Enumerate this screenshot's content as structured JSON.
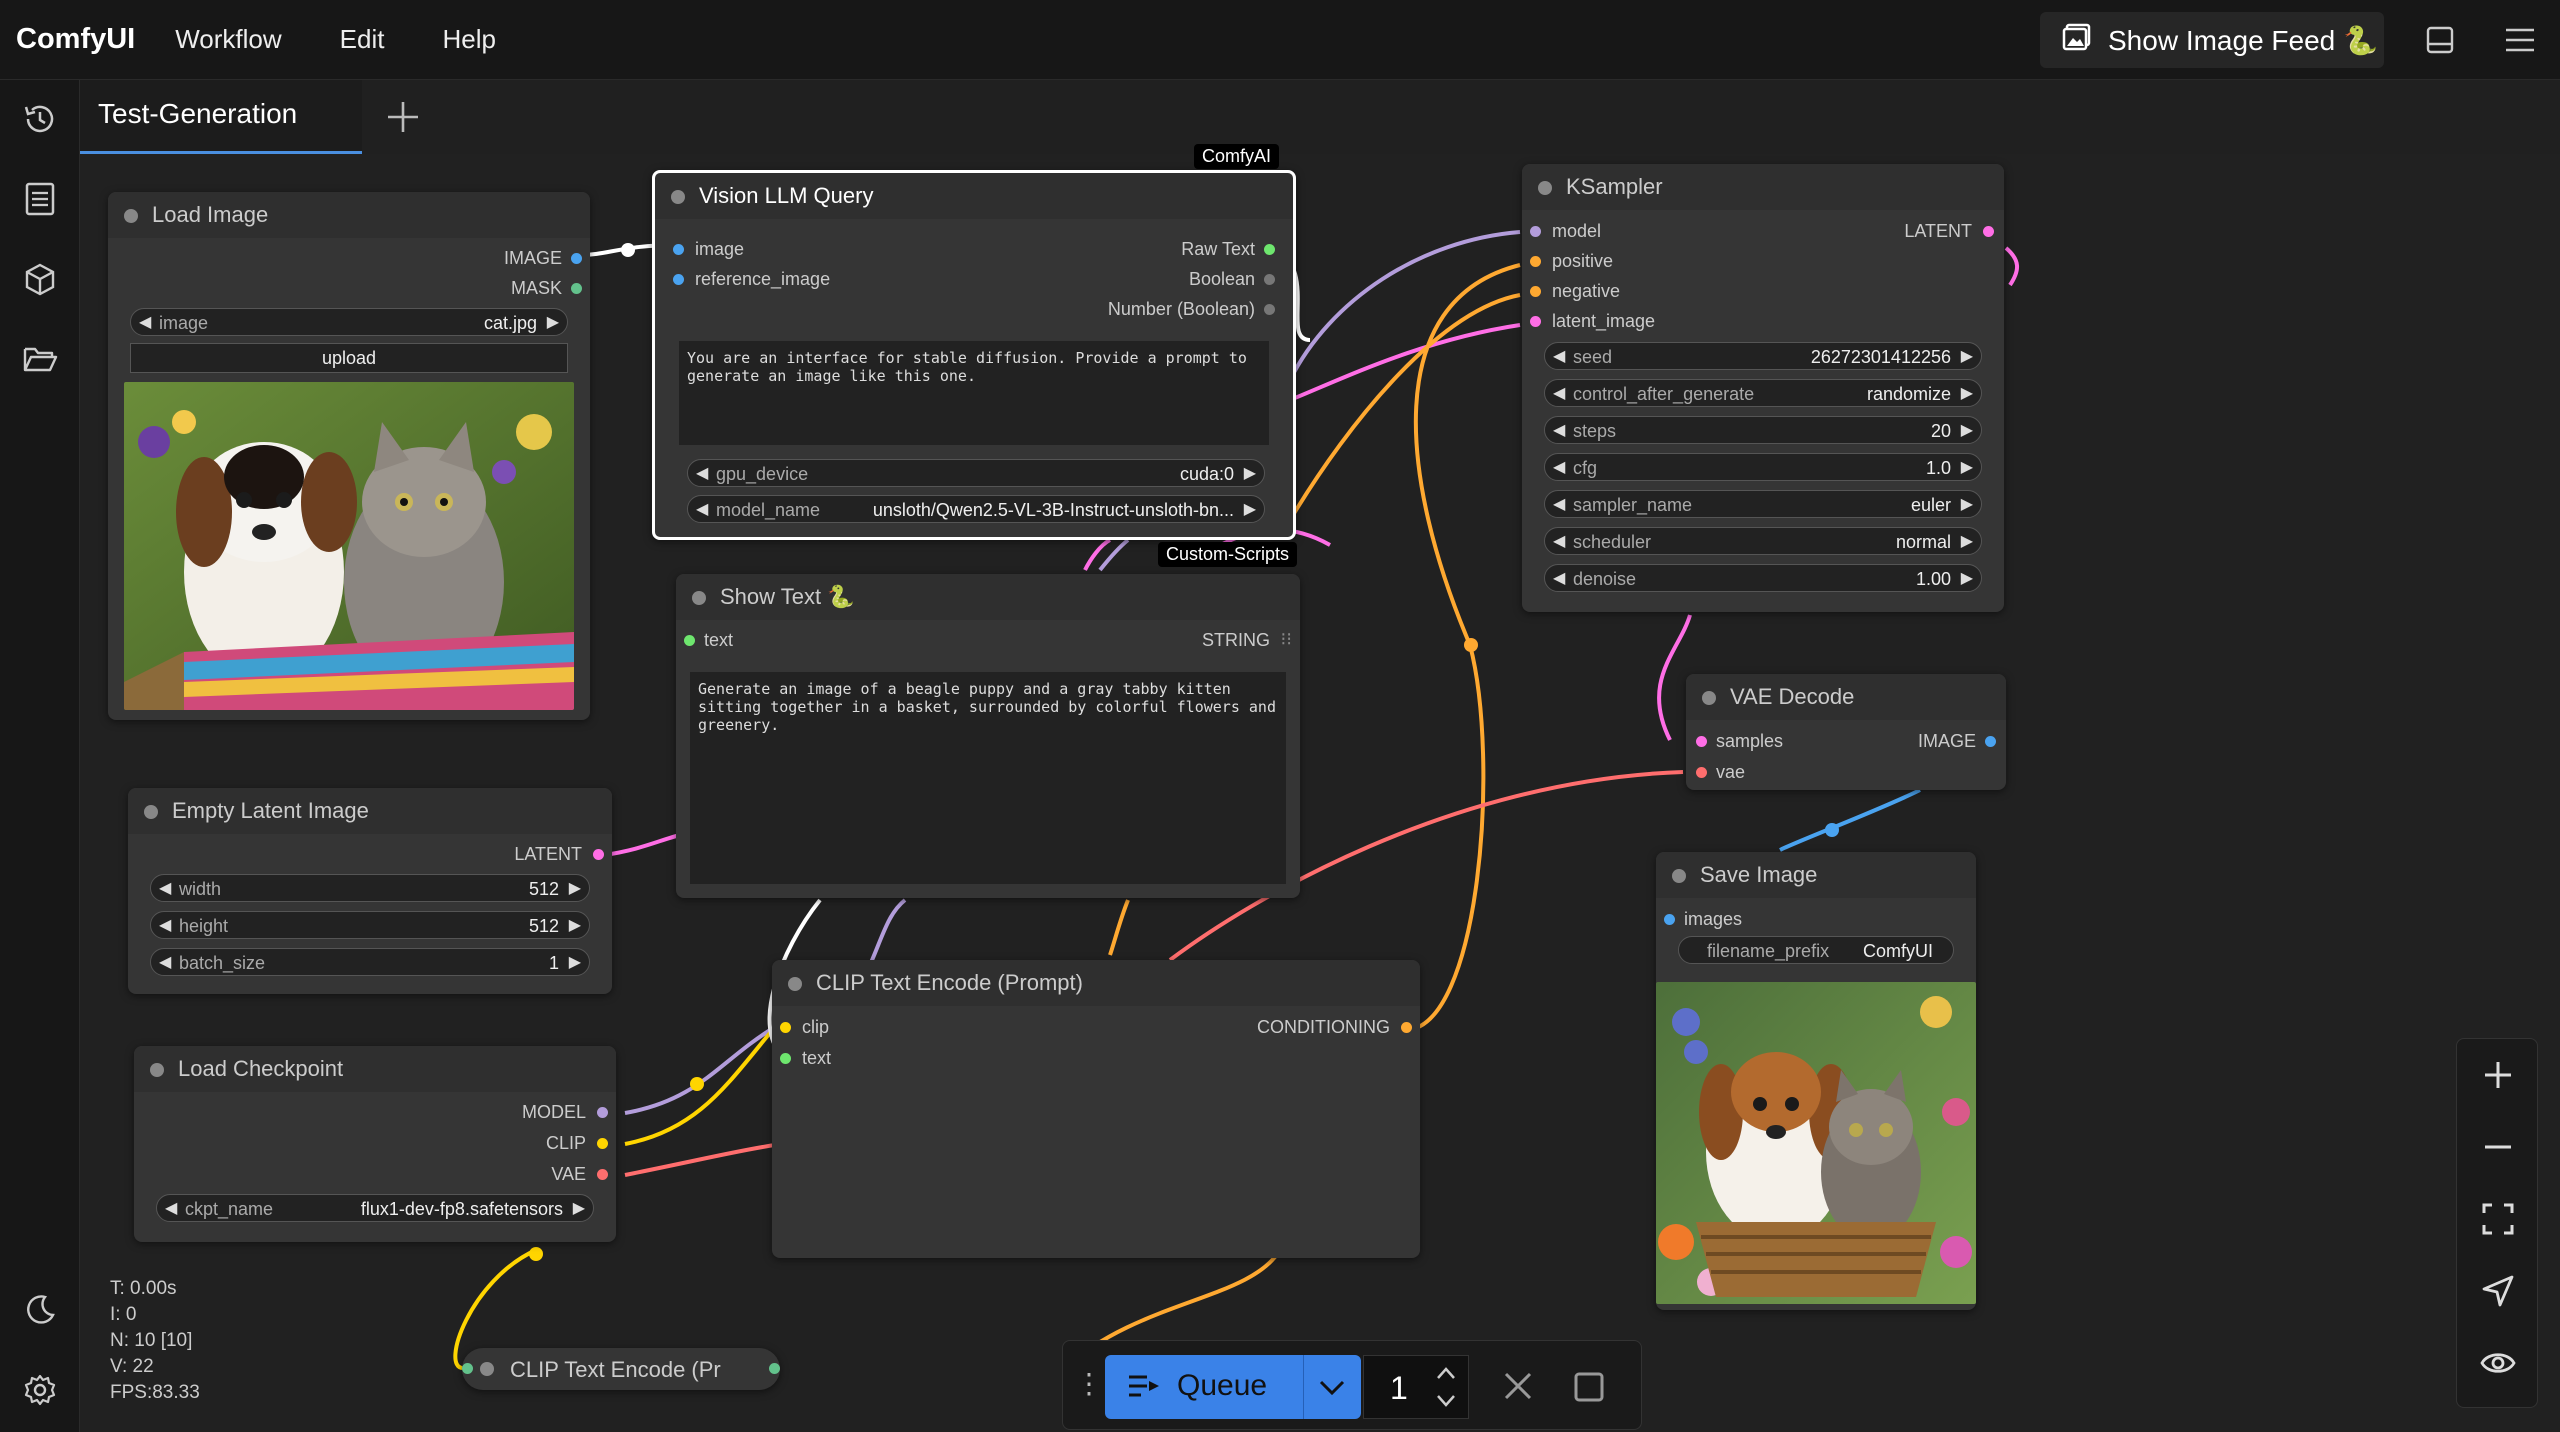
{
  "app": {
    "brand": "ComfyUI"
  },
  "menu": [
    "Workflow",
    "Edit",
    "Help"
  ],
  "feed_button": {
    "label": "Show Image Feed 🐍"
  },
  "tabs": [
    {
      "label": "Test-Generation"
    }
  ],
  "colors": {
    "accent": "#3a82e8",
    "image_slot": "#4aa3f0",
    "mask_slot": "#63c28c",
    "latent_slot": "#ff6ee6",
    "conditioning_slot": "#ffa931",
    "clip_slot": "#ffd500",
    "model_slot": "#b39ddb",
    "vae_slot": "#ff6e6e",
    "string_slot": "#6ee66e"
  },
  "nodes": {
    "load_image": {
      "title": "Load Image",
      "out1": "IMAGE",
      "out2": "MASK",
      "image_label": "image",
      "image_value": "cat.jpg",
      "upload_label": "upload"
    },
    "vision_llm": {
      "badge": "ComfyAI",
      "title": "Vision LLM Query",
      "in1": "image",
      "in2": "reference_image",
      "out1": "Raw Text",
      "out2": "Boolean",
      "out3": "Number (Boolean)",
      "prompt": "You are an interface for stable diffusion. Provide a prompt to generate an image like this one.",
      "gpu_label": "gpu_device",
      "gpu_value": "cuda:0",
      "model_label": "model_name",
      "model_value": "unsloth/Qwen2.5-VL-3B-Instruct-unsloth-bn..."
    },
    "show_text": {
      "badge": "Custom-Scripts",
      "title": "Show Text 🐍",
      "in1": "text",
      "out1": "STRING",
      "content": "Generate an image of a beagle puppy and a gray tabby kitten sitting together in a basket, surrounded by colorful flowers and greenery."
    },
    "ksampler": {
      "title": "KSampler",
      "in1": "model",
      "in2": "positive",
      "in3": "negative",
      "in4": "latent_image",
      "out1": "LATENT",
      "widgets": [
        {
          "label": "seed",
          "value": "26272301412256"
        },
        {
          "label": "control_after_generate",
          "value": "randomize"
        },
        {
          "label": "steps",
          "value": "20"
        },
        {
          "label": "cfg",
          "value": "1.0"
        },
        {
          "label": "sampler_name",
          "value": "euler"
        },
        {
          "label": "scheduler",
          "value": "normal"
        },
        {
          "label": "denoise",
          "value": "1.00"
        }
      ]
    },
    "vae_decode": {
      "title": "VAE Decode",
      "in1": "samples",
      "in2": "vae",
      "out1": "IMAGE"
    },
    "save_image": {
      "title": "Save Image",
      "in1": "images",
      "prefix_label": "filename_prefix",
      "prefix_value": "ComfyUI"
    },
    "empty_latent": {
      "title": "Empty Latent Image",
      "out1": "LATENT",
      "widgets": [
        {
          "label": "width",
          "value": "512"
        },
        {
          "label": "height",
          "value": "512"
        },
        {
          "label": "batch_size",
          "value": "1"
        }
      ]
    },
    "load_checkpoint": {
      "title": "Load Checkpoint",
      "out1": "MODEL",
      "out2": "CLIP",
      "out3": "VAE",
      "ckpt_label": "ckpt_name",
      "ckpt_value": "flux1-dev-fp8.safetensors"
    },
    "clip_encode": {
      "title": "CLIP Text Encode (Prompt)",
      "in1": "clip",
      "in2": "text",
      "out1": "CONDITIONING"
    },
    "clip_encode_collapsed": {
      "title": "CLIP Text Encode (Pr"
    }
  },
  "stats": {
    "t": "T: 0.00s",
    "i": "I: 0",
    "n": "N: 10 [10]",
    "v": "V: 22",
    "fps": "FPS:83.33"
  },
  "queue": {
    "label": "Queue",
    "count": "1"
  }
}
